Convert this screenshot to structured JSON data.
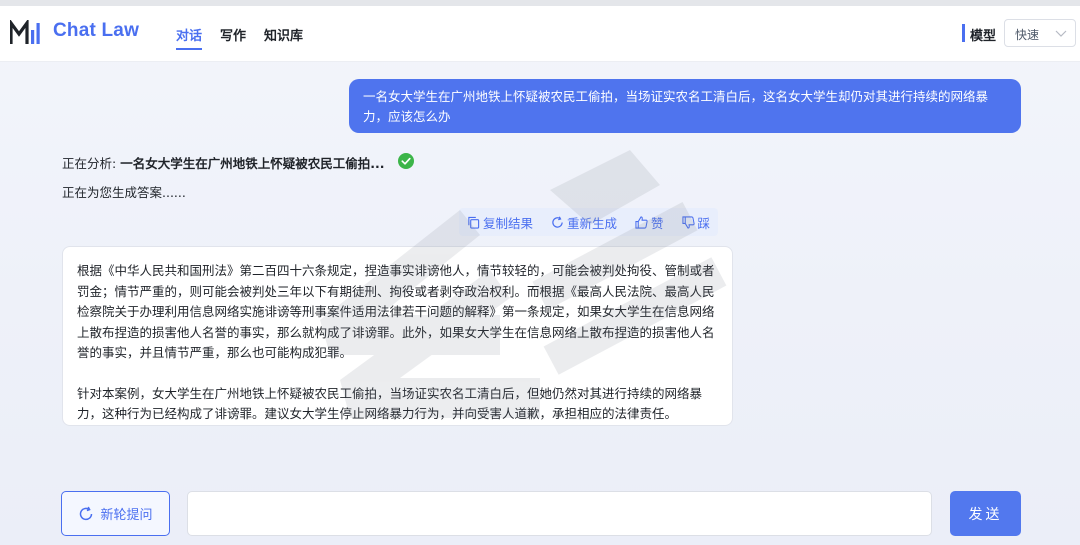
{
  "header": {
    "brand": "Chat Law",
    "nav": [
      {
        "label": "对话",
        "active": true
      },
      {
        "label": "写作",
        "active": false
      },
      {
        "label": "知识库",
        "active": false
      }
    ],
    "model_label": "模型",
    "model_value": "快速"
  },
  "conversation": {
    "user_message": "一名女大学生在广州地铁上怀疑被农民工偷拍，当场证实农名工清白后，这名女大学生却仍对其进行持续的网络暴力，应该怎么办",
    "analyzing_label": "正在分析:",
    "analyzing_query": "一名女大学生在广州地铁上怀疑被农民工偷拍...",
    "generating": "正在为您生成答案......",
    "actions": {
      "copy": "复制结果",
      "regenerate": "重新生成",
      "like": "赞",
      "dislike": "踩"
    },
    "answer_paragraphs": [
      "根据《中华人民共和国刑法》第二百四十六条规定，捏造事实诽谤他人，情节较轻的，可能会被判处拘役、管制或者罚金；情节严重的，则可能会被判处三年以下有期徒刑、拘役或者剥夺政治权利。而根据《最高人民法院、最高人民检察院关于办理利用信息网络实施诽谤等刑事案件适用法律若干问题的解释》第一条规定，如果女大学生在信息网络上散布捏造的损害他人名誉的事实，那么就构成了诽谤罪。此外，如果女大学生在信息网络上散布捏造的损害他人名誉的事实，并且情节严重，那么也可能构成犯罪。",
      "针对本案例，女大学生在广州地铁上怀疑被农民工偷拍，当场证实农名工清白后，但她仍然对其进行持续的网络暴力，这种行为已经构成了诽谤罪。建议女大学生停止网络暴力行为，并向受害人道歉，承担相应的法律责任。"
    ]
  },
  "footer": {
    "new_question": "新轮提问",
    "input_value": "",
    "input_placeholder": "",
    "send": "发送"
  },
  "colors": {
    "accent": "#4a6ff0",
    "bubble": "#4f74ee",
    "check": "#3cb549"
  }
}
